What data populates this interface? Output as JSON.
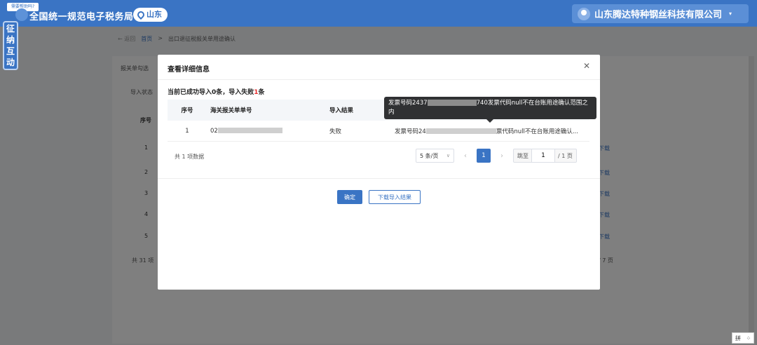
{
  "header": {
    "help_chip": "需要帮助吗?",
    "system_title": "全国统一规范电子税务局",
    "region": "山东",
    "company": "山东腾达特种钢丝科技有限公司"
  },
  "side_tab": "征纳互动",
  "breadcrumb": {
    "back": "← 返回",
    "home": "首页",
    "sep": ">",
    "current": "出口退征税报关单用途确认"
  },
  "background": {
    "tab_label": "报关单勾选",
    "status_label": "导入状态",
    "seq_header": "序号",
    "rows": [
      "1",
      "2",
      "3",
      "4",
      "5"
    ],
    "row_link": "下载",
    "total": "共 31 项",
    "pages": "/ 7 页"
  },
  "modal": {
    "title": "查看详细信息",
    "summary_prefix": "当前已成功导入0条，导入失败",
    "fail_count": "1",
    "summary_suffix": "条",
    "columns": {
      "seq": "序号",
      "bill": "海关报关单单号",
      "result": "导入结果",
      "reason": ""
    },
    "row": {
      "seq": "1",
      "bill_prefix": "02",
      "bill_suffix": "",
      "result": "失败",
      "reason_prefix": "发票号码24",
      "reason_suffix": "票代码null不在台账用途确认..."
    },
    "tooltip": {
      "prefix": "发票号码2437",
      "suffix": "740发票代码null不在台账用途确认范围之内"
    },
    "total_records": "共 1 项数据",
    "pager": {
      "page_size": "5 条/页",
      "prev": "‹",
      "current_page": "1",
      "next": "›",
      "jump_label": "跳至",
      "jump_value": "1",
      "total_pages": "/ 1 页"
    },
    "ok_button": "确定",
    "download_button": "下载导入结果"
  },
  "ime": {
    "mode": "拼"
  }
}
